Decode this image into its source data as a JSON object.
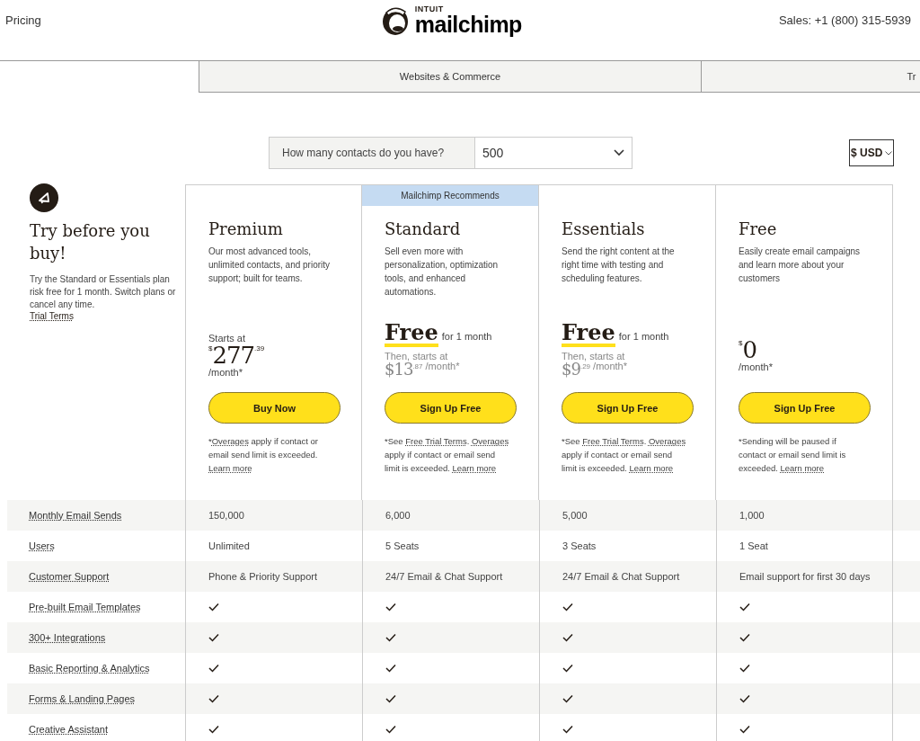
{
  "header": {
    "nav_link": "Pricing",
    "logo": {
      "small": "INTUIT",
      "large": "mailchimp"
    },
    "sales": "Sales: +1 (800) 315-5939"
  },
  "tabs": [
    {
      "label": "Websites & Commerce"
    },
    {
      "label": "Tr"
    }
  ],
  "contacts": {
    "question": "How many contacts do you have?",
    "value": "500"
  },
  "currency": {
    "value": "$ USD"
  },
  "intro": {
    "title": "Try before you buy!",
    "text": "Try the Standard or Essentials plan risk free for 1 month. Switch plans or cancel any time.",
    "link": "Trial Terms"
  },
  "plans": [
    {
      "name": "Premium",
      "description": "Our most advanced tools, unlimited contacts, and priority support; built for teams.",
      "price": {
        "kind": "starts",
        "label": "Starts at",
        "currency": "$",
        "whole": "277",
        "cents": ".39",
        "period": "/month*"
      },
      "button": "Buy Now",
      "footnote": [
        {
          "text": "*"
        },
        {
          "text": "Overages",
          "link": true
        },
        {
          "text": " apply if contact or email send limit is exceeded. "
        },
        {
          "text": "Learn more",
          "link": true
        }
      ]
    },
    {
      "name": "Standard",
      "banner": "Mailchimp Recommends",
      "description": "Sell even more with personalization, optimization tools, and enhanced automations.",
      "price": {
        "kind": "trial",
        "headline": "Free",
        "duration": "for 1 month",
        "label": "Then, starts at",
        "whole": "$13",
        "cents": ".87",
        "period": "/month*"
      },
      "button": "Sign Up Free",
      "footnote": [
        {
          "text": "*See "
        },
        {
          "text": "Free Trial Terms",
          "link": true
        },
        {
          "text": ". "
        },
        {
          "text": "Overages",
          "link": true
        },
        {
          "text": " apply if contact or email send limit is exceeded. "
        },
        {
          "text": "Learn more",
          "link": true
        }
      ]
    },
    {
      "name": "Essentials",
      "description": "Send the right content at the right time with testing and scheduling features.",
      "price": {
        "kind": "trial",
        "headline": "Free",
        "duration": "for 1 month",
        "label": "Then, starts at",
        "whole": "$9",
        "cents": ".29",
        "period": "/month*"
      },
      "button": "Sign Up Free",
      "footnote": [
        {
          "text": "*See "
        },
        {
          "text": "Free Trial Terms",
          "link": true
        },
        {
          "text": ". "
        },
        {
          "text": "Overages",
          "link": true
        },
        {
          "text": " apply if contact or email send limit is exceeded. "
        },
        {
          "text": "Learn more",
          "link": true
        }
      ]
    },
    {
      "name": "Free",
      "description": "Easily create email campaigns and learn more about your customers",
      "price": {
        "kind": "flat",
        "currency": "$",
        "whole": "0",
        "period": "/month*"
      },
      "button": "Sign Up Free",
      "footnote": [
        {
          "text": "*Sending will be paused if contact or email send limit is exceeded. "
        },
        {
          "text": "Learn more",
          "link": true
        }
      ]
    }
  ],
  "features": [
    {
      "label": "Monthly Email Sends",
      "cells": [
        {
          "kind": "text",
          "text": "150,000"
        },
        {
          "kind": "text",
          "text": "6,000"
        },
        {
          "kind": "text",
          "text": "5,000"
        },
        {
          "kind": "text",
          "text": "1,000"
        }
      ]
    },
    {
      "label": "Users",
      "cells": [
        {
          "kind": "text",
          "text": "Unlimited"
        },
        {
          "kind": "text",
          "text": "5 Seats"
        },
        {
          "kind": "text",
          "text": "3 Seats"
        },
        {
          "kind": "text",
          "text": "1 Seat"
        }
      ]
    },
    {
      "label": "Customer Support",
      "cells": [
        {
          "kind": "text",
          "text": "Phone & Priority Support"
        },
        {
          "kind": "text",
          "text": "24/7 Email & Chat Support"
        },
        {
          "kind": "text",
          "text": "24/7 Email & Chat Support"
        },
        {
          "kind": "text",
          "text": "Email support for first 30 days"
        }
      ]
    },
    {
      "label": "Pre-built Email Templates",
      "cells": [
        {
          "kind": "check"
        },
        {
          "kind": "check"
        },
        {
          "kind": "check"
        },
        {
          "kind": "check"
        }
      ]
    },
    {
      "label": "300+ Integrations",
      "cells": [
        {
          "kind": "check"
        },
        {
          "kind": "check"
        },
        {
          "kind": "check"
        },
        {
          "kind": "check"
        }
      ]
    },
    {
      "label": "Basic Reporting & Analytics",
      "cells": [
        {
          "kind": "check"
        },
        {
          "kind": "check"
        },
        {
          "kind": "check"
        },
        {
          "kind": "check"
        }
      ]
    },
    {
      "label": "Forms & Landing Pages",
      "cells": [
        {
          "kind": "check"
        },
        {
          "kind": "check"
        },
        {
          "kind": "check"
        },
        {
          "kind": "check"
        }
      ]
    },
    {
      "label": "Creative Assistant",
      "cells": [
        {
          "kind": "check"
        },
        {
          "kind": "check"
        },
        {
          "kind": "check"
        },
        {
          "kind": "check"
        }
      ]
    }
  ]
}
